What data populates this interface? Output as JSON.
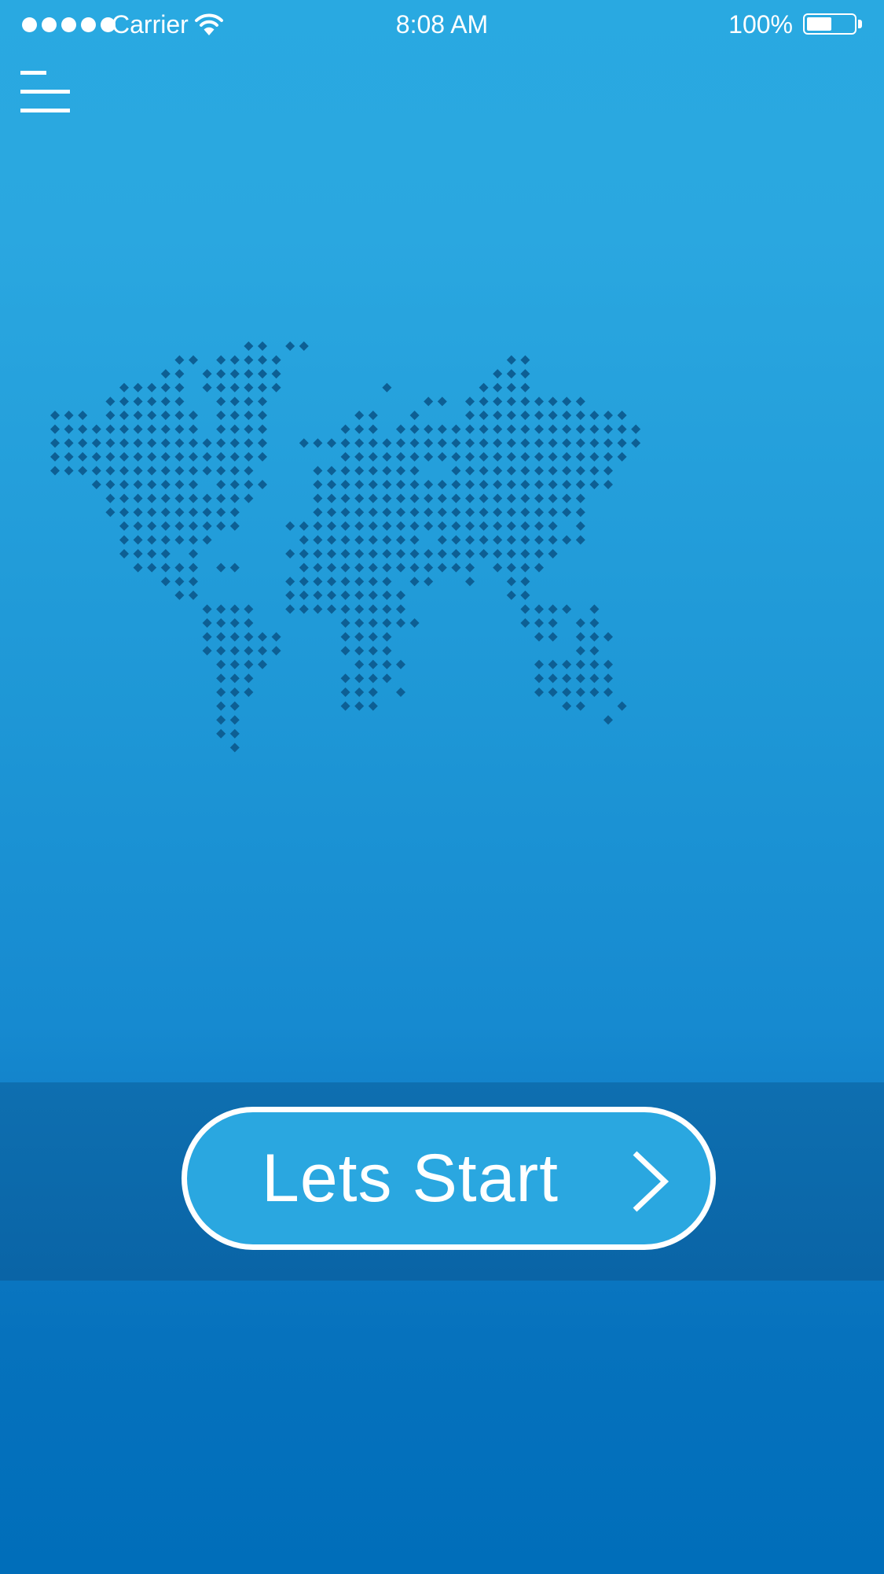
{
  "status_bar": {
    "carrier": "Carrier",
    "time": "8:08 AM",
    "battery_percent": "100%",
    "battery_level": 0.55,
    "signal_strength": 5
  },
  "nav": {
    "menu_icon": "hamburger-menu-icon"
  },
  "hero": {
    "map_icon": "dotted-world-map"
  },
  "action": {
    "start_label": "Lets Start",
    "arrow_icon": "chevron-right-icon"
  },
  "colors": {
    "background_top": "#29a9e1",
    "background_bottom": "#006eba",
    "band": "#0a64a6",
    "button_fill": "#2aa7e0",
    "map_dots": "#0d5f94",
    "foreground": "#ffffff"
  }
}
